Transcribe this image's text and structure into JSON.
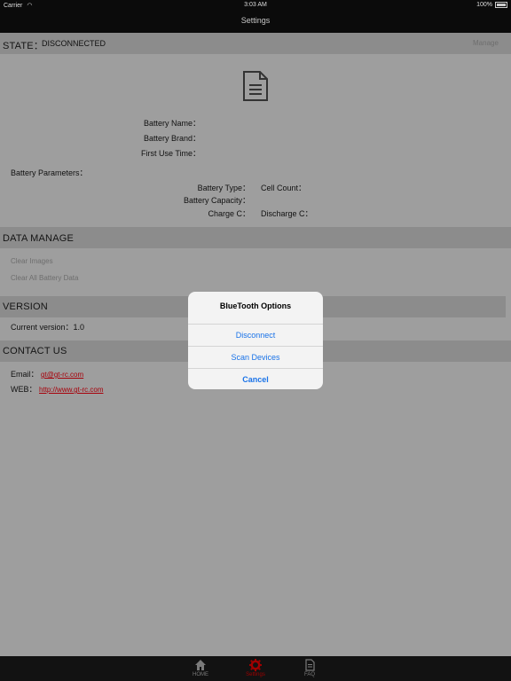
{
  "status_bar": {
    "carrier": "Carrier",
    "time": "3:03 AM",
    "battery": "100%"
  },
  "nav": {
    "title": "Settings"
  },
  "state": {
    "label": "STATE：",
    "value": "DISCONNECTED",
    "manage": "Manage"
  },
  "battery_info": {
    "name_label": "Battery Name：",
    "brand_label": "Battery Brand：",
    "first_use_label": "First Use Time："
  },
  "parameters": {
    "title": "Battery Parameters：",
    "type_label": "Battery Type：",
    "cell_count_label": "Cell Count：",
    "capacity_label": "Battery Capacity：",
    "charge_label": "Charge C：",
    "discharge_label": "Discharge C："
  },
  "data_manage": {
    "title": "DATA MANAGE",
    "clear_images": "Clear Images",
    "clear_all": "Clear All Battery Data"
  },
  "version": {
    "title": "VERSION",
    "label": "Current version：",
    "value": "1.0"
  },
  "contact": {
    "title": "CONTACT US",
    "email_label": "Email：",
    "email": "gt@gt-rc.com",
    "web_label": "WEB：",
    "web": "http://www.gt-rc.com"
  },
  "alert": {
    "title": "BlueTooth Options",
    "options": [
      "Disconnect",
      "Scan Devices",
      "Cancel"
    ]
  },
  "tabs": [
    {
      "label": "HOME",
      "icon": "home-icon"
    },
    {
      "label": "Settings",
      "icon": "gear-icon"
    },
    {
      "label": "FAQ",
      "icon": "document-icon"
    }
  ],
  "colors": {
    "accent_red": "#a00000",
    "link_blue": "#1a73e8",
    "link_red": "#a7000a"
  }
}
